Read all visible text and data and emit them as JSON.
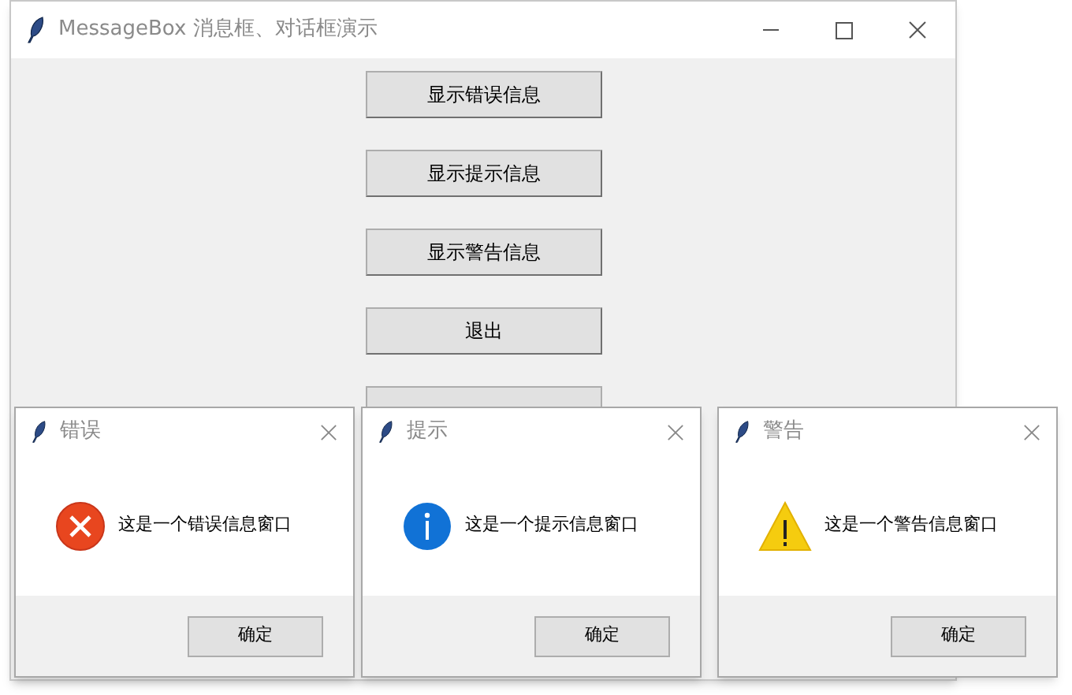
{
  "window": {
    "title": "MessageBox 消息框、对话框演示"
  },
  "buttons": [
    "显示错误信息",
    "显示提示信息",
    "显示警告信息",
    "退出"
  ],
  "dialogs": [
    {
      "kind": "error",
      "title": "错误",
      "message": "这是一个错误信息窗口",
      "button": "确定"
    },
    {
      "kind": "info",
      "title": "提示",
      "message": "这是一个提示信息窗口",
      "button": "确定"
    },
    {
      "kind": "warning",
      "title": "警告",
      "message": "这是一个警告信息窗口",
      "button": "确定"
    }
  ]
}
